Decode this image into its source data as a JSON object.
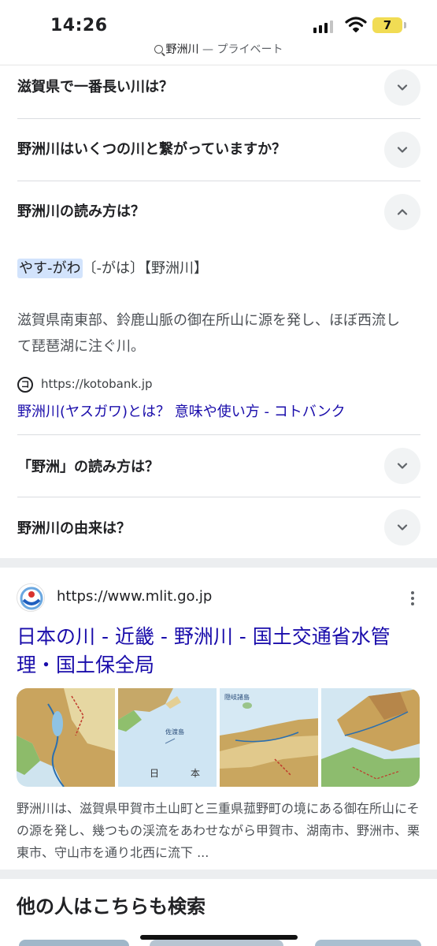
{
  "status": {
    "time": "14:26",
    "battery": "7"
  },
  "url_bar": {
    "query": "野洲川",
    "suffix": " — プライベート"
  },
  "faq": {
    "q1": "滋賀県で一番長い川は？",
    "q2": "野洲川はいくつの川と繋がっていますか？",
    "q3": "野洲川の読み方は？",
    "answer": {
      "reading_highlight": "やす-がわ",
      "reading_rest": "〔-がは〕【野洲川】",
      "body": "滋賀県南東部、鈴鹿山脈の御在所山に源を発し、ほぼ西流して琵琶湖に注ぐ川。",
      "source_icon_letter": "コ",
      "source_url": "https://kotobank.jp",
      "source_link": "野洲川(ヤスガワ)とは？ 意味や使い方 - コトバンク"
    },
    "q4": "「野洲」の読み方は？",
    "q5": "野洲川の由来は？"
  },
  "result": {
    "url": "https://www.mlit.go.jp",
    "title": "日本の川 - 近畿 - 野洲川 - 国土交通省水管理・国土保全局",
    "map_labels": {
      "m2_a": "佐渡島",
      "m2_b": "日",
      "m2_c": "本",
      "m3_a": "隠岐諸島"
    },
    "snippet": "野洲川は、滋賀県甲賀市土山町と三重県菰野町の境にある御在所山にその源を発し、幾つもの渓流をあわせながら甲賀市、湖南市、野洲市、栗東市、守山市を通り北西に流下 ..."
  },
  "related_title": "他の人はこちらも検索",
  "colors": {
    "link": "#1a0dab",
    "highlight": "#d2e3fc",
    "chevron_bg": "#f1f3f4"
  },
  "icons": [
    "search-icon",
    "signal-icon",
    "wifi-icon",
    "battery-icon",
    "chevron-down-icon",
    "chevron-up-icon",
    "kotobank-icon",
    "mlit-logo-icon",
    "more-vert-icon"
  ]
}
